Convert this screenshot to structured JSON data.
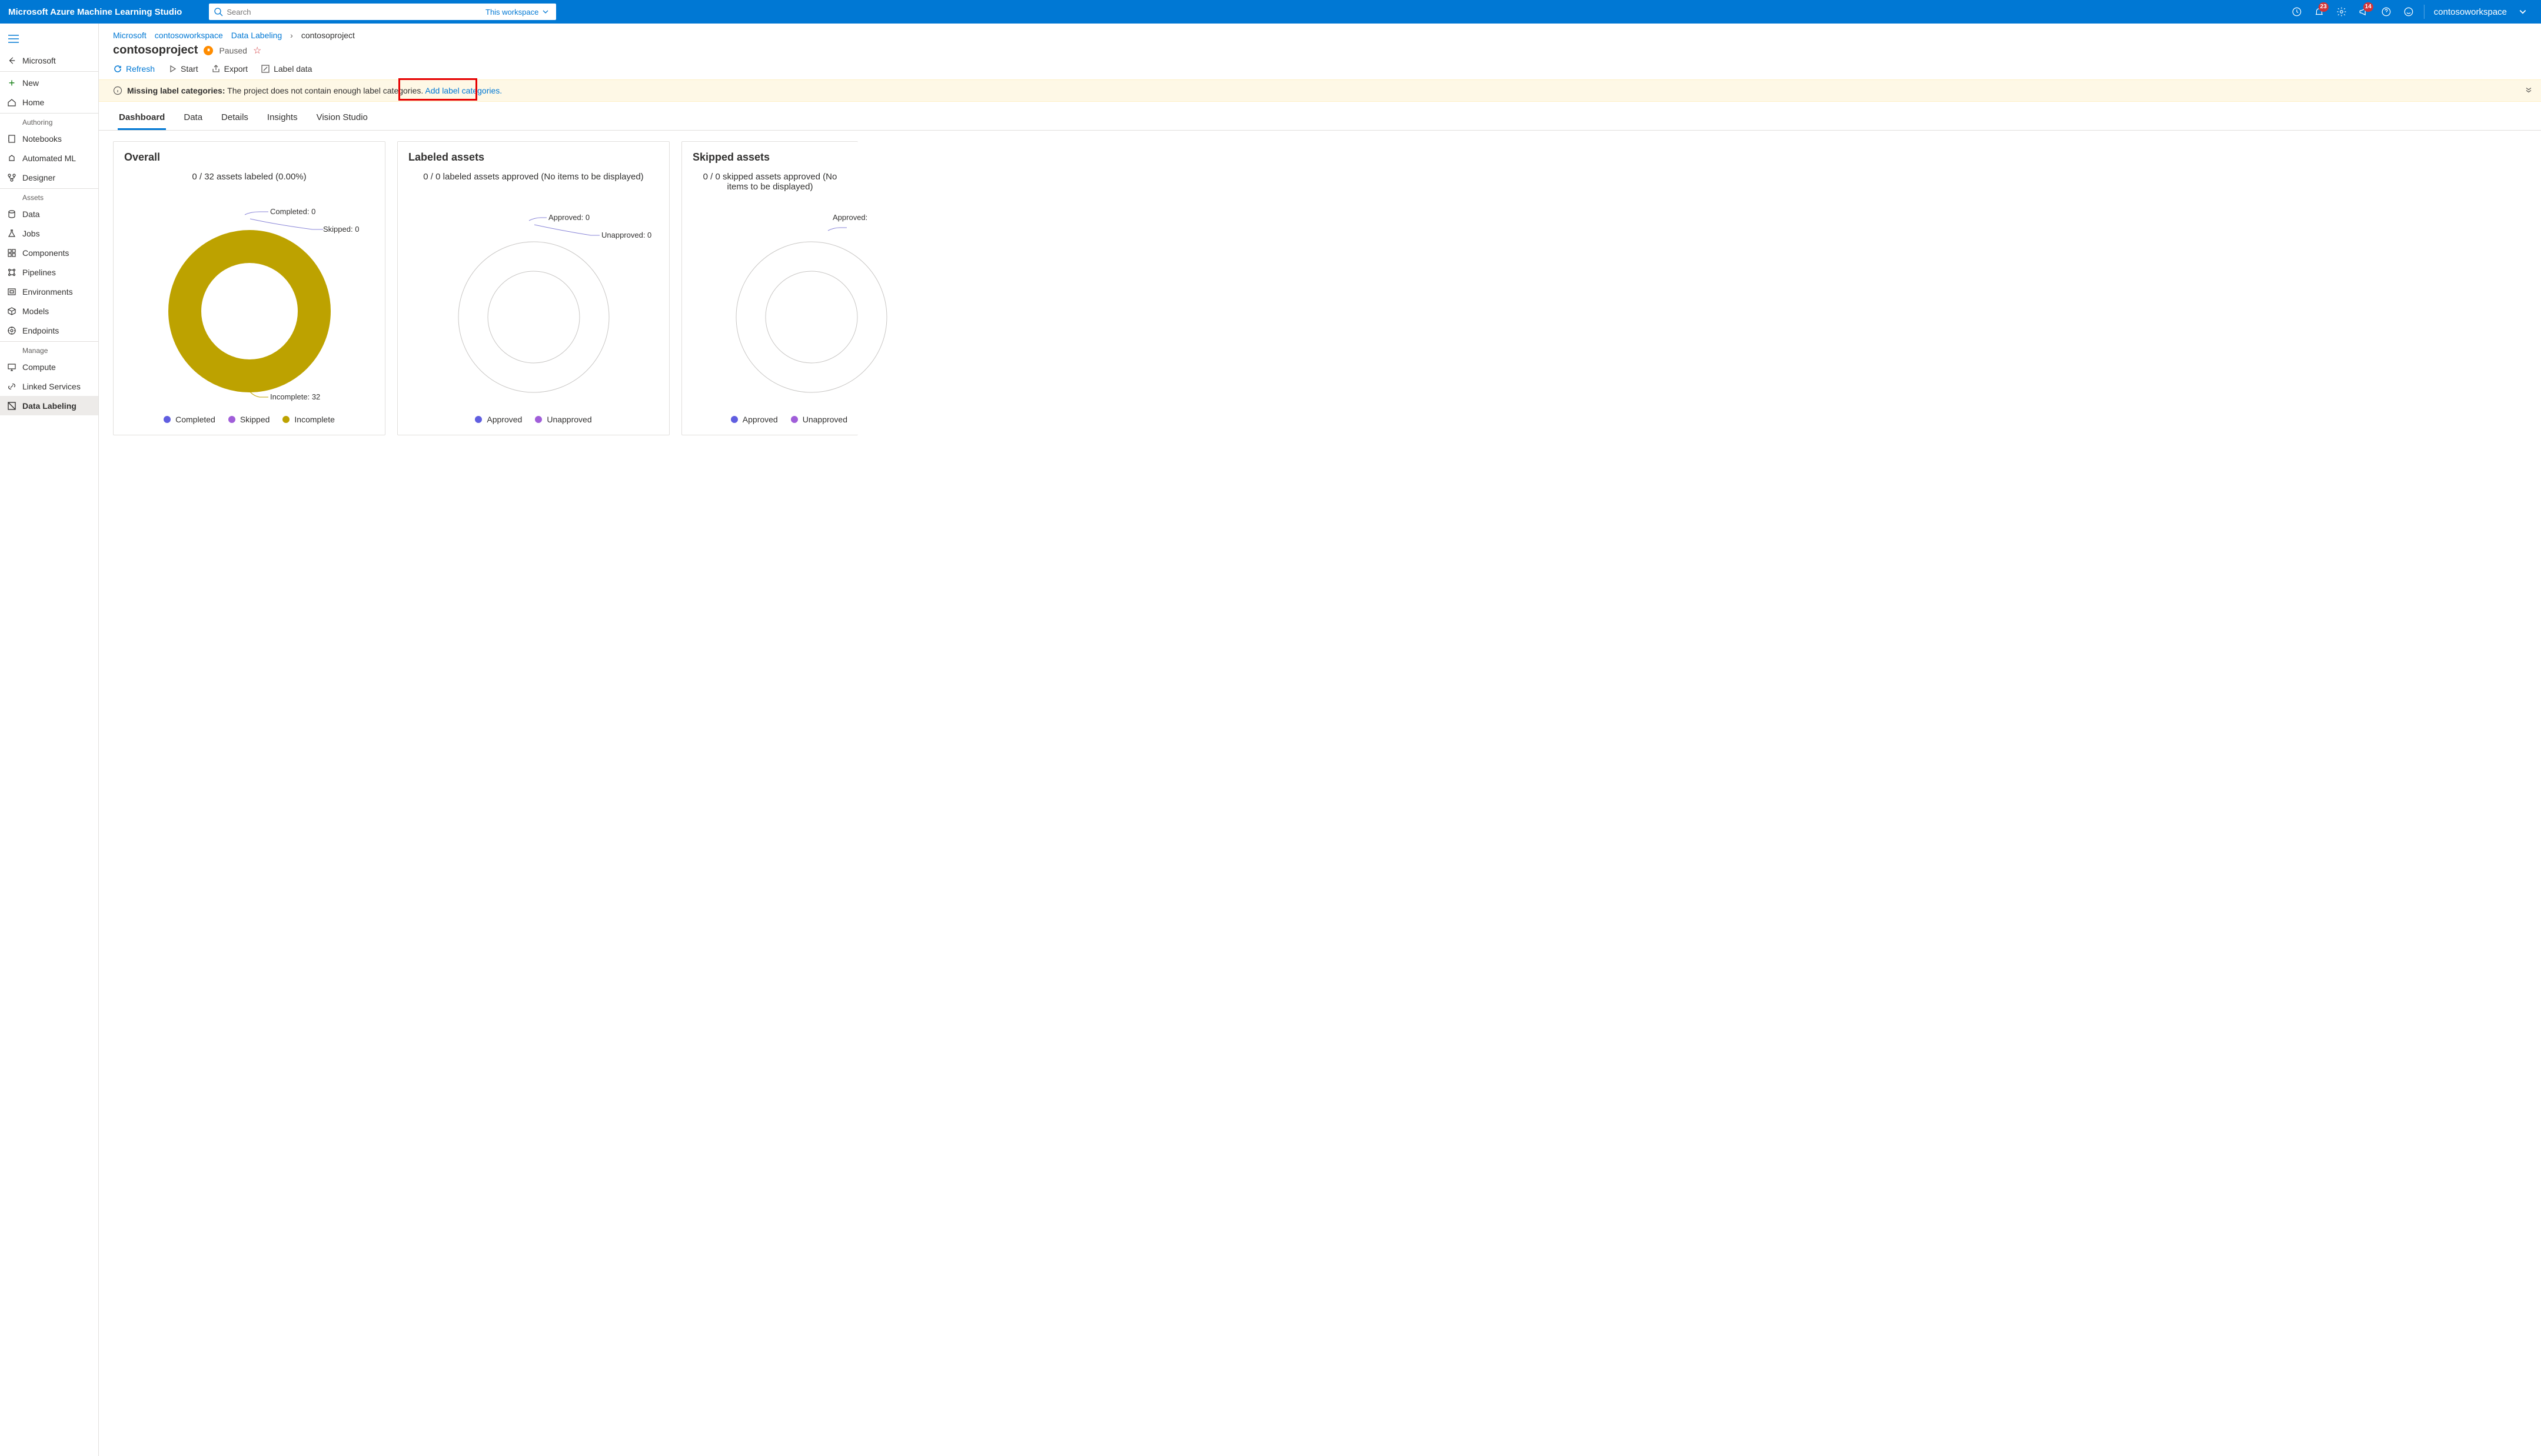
{
  "header": {
    "product": "Microsoft Azure Machine Learning Studio",
    "search_placeholder": "Search",
    "scope": "This workspace",
    "notif_badge": "23",
    "chat_badge": "14",
    "workspace": "contosoworkspace"
  },
  "sidebar": {
    "back": "Microsoft",
    "new": "New",
    "home": "Home",
    "group_auth": "Authoring",
    "notebooks": "Notebooks",
    "automl": "Automated ML",
    "designer": "Designer",
    "group_assets": "Assets",
    "data": "Data",
    "jobs": "Jobs",
    "components": "Components",
    "pipelines": "Pipelines",
    "environments": "Environments",
    "models": "Models",
    "endpoints": "Endpoints",
    "group_manage": "Manage",
    "compute": "Compute",
    "linked": "Linked Services",
    "labeling": "Data Labeling"
  },
  "crumbs": {
    "c0": "Microsoft",
    "c1": "contosoworkspace",
    "c2": "Data Labeling",
    "c3": "contosoproject"
  },
  "page": {
    "title": "contosoproject",
    "status": "Paused"
  },
  "cmd": {
    "refresh": "Refresh",
    "start": "Start",
    "export": "Export",
    "label": "Label data"
  },
  "banner": {
    "prefix": "Missing label categories:",
    "msg": "The project does not contain enough label categories.",
    "link": "Add label categories."
  },
  "tabs": {
    "t0": "Dashboard",
    "t1": "Data",
    "t2": "Details",
    "t3": "Insights",
    "t4": "Vision Studio"
  },
  "cards": {
    "overall": {
      "title": "Overall",
      "subtitle": "0 / 32 assets labeled (0.00%)",
      "c0": "Completed: 0",
      "c1": "Skipped: 0",
      "c2": "Incomplete: 32",
      "l0": "Completed",
      "l1": "Skipped",
      "l2": "Incomplete"
    },
    "labeled": {
      "title": "Labeled assets",
      "subtitle": "0 / 0 labeled assets approved (No items to be displayed)",
      "c0": "Approved: 0",
      "c1": "Unapproved: 0",
      "l0": "Approved",
      "l1": "Unapproved"
    },
    "skipped": {
      "title": "Skipped assets",
      "subtitle": "0 / 0 skipped assets approved (No items to be displayed)",
      "c0": "Approved:",
      "l0": "Approved",
      "l1": "Unapproved"
    }
  },
  "chart_data": [
    {
      "type": "pie",
      "title": "Overall — 0 / 32 assets labeled (0.00%)",
      "categories": [
        "Completed",
        "Skipped",
        "Incomplete"
      ],
      "values": [
        0,
        0,
        32
      ],
      "colors": [
        "#605ee0",
        "#a05ed9",
        "#bda200"
      ]
    },
    {
      "type": "pie",
      "title": "Labeled assets — 0 / 0 labeled assets approved",
      "categories": [
        "Approved",
        "Unapproved"
      ],
      "values": [
        0,
        0
      ],
      "colors": [
        "#605ee0",
        "#a05ed9"
      ]
    },
    {
      "type": "pie",
      "title": "Skipped assets — 0 / 0 skipped assets approved",
      "categories": [
        "Approved",
        "Unapproved"
      ],
      "values": [
        0,
        0
      ],
      "colors": [
        "#605ee0",
        "#a05ed9"
      ]
    }
  ]
}
